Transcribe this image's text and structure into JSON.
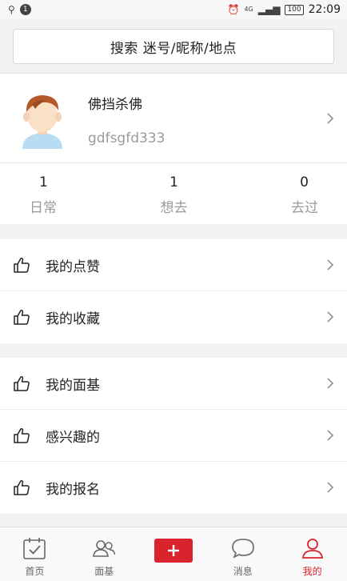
{
  "status_bar": {
    "left_icons": [
      "usb-icon",
      "notification-icon"
    ],
    "notification_badge": "1",
    "network": "4G",
    "battery": "100",
    "time": "22:09"
  },
  "search": {
    "label": "搜索 迷号/昵称/地点"
  },
  "profile": {
    "nickname": "佛挡杀佛",
    "username": "gdfsgfd333",
    "avatar_icon": "boy-avatar"
  },
  "stats": [
    {
      "count": "1",
      "label": "日常"
    },
    {
      "count": "1",
      "label": "想去"
    },
    {
      "count": "0",
      "label": "去过"
    }
  ],
  "menu_group_1": [
    {
      "label": "我的点赞",
      "icon": "thumbs-up-icon"
    },
    {
      "label": "我的收藏",
      "icon": "thumbs-up-icon"
    }
  ],
  "menu_group_2": [
    {
      "label": "我的面基",
      "icon": "thumbs-up-icon"
    },
    {
      "label": "感兴趣的",
      "icon": "thumbs-up-icon"
    },
    {
      "label": "我的报名",
      "icon": "thumbs-up-icon"
    }
  ],
  "bottom_nav": [
    {
      "label": "首页",
      "icon": "calendar-check-icon"
    },
    {
      "label": "面基",
      "icon": "people-icon"
    },
    {
      "label": "",
      "icon": "plus-icon"
    },
    {
      "label": "消息",
      "icon": "chat-bubble-icon"
    },
    {
      "label": "我的",
      "icon": "person-icon",
      "active": true
    }
  ],
  "colors": {
    "accent": "#d9232d",
    "background": "#f2f2f2",
    "muted_text": "#9a9a9a"
  }
}
